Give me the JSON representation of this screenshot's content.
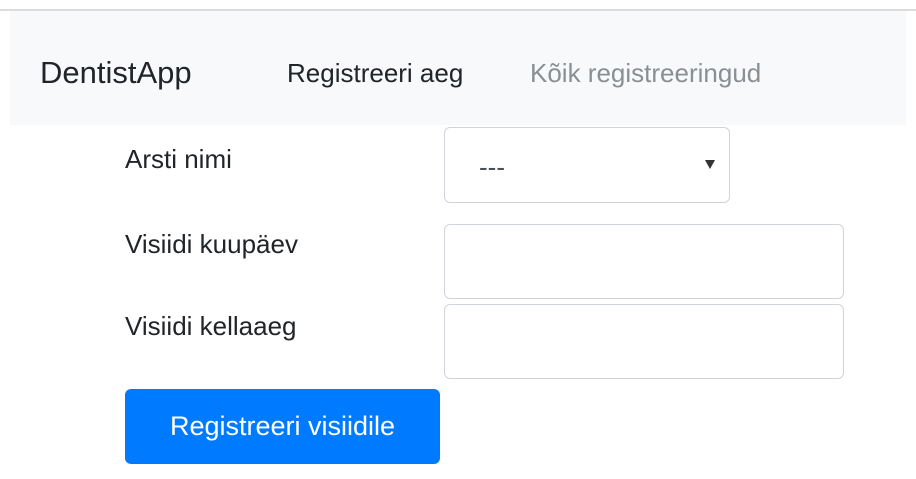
{
  "navbar": {
    "brand": "DentistApp",
    "links": [
      {
        "label": "Registreeri aeg",
        "active": true
      },
      {
        "label": "Kõik registreeringud",
        "active": false
      }
    ]
  },
  "form": {
    "doctor": {
      "label": "Arsti nimi",
      "selected": "---",
      "icon": "caret-down-icon"
    },
    "date": {
      "label": "Visiidi kuupäev",
      "value": ""
    },
    "time": {
      "label": "Visiidi kellaaeg",
      "value": ""
    },
    "submit_label": "Registreeri visiidile"
  },
  "colors": {
    "primary": "#007bff",
    "navbar_bg": "#f8f9fa",
    "muted_link": "#8a8f94",
    "border": "#ced4da"
  }
}
